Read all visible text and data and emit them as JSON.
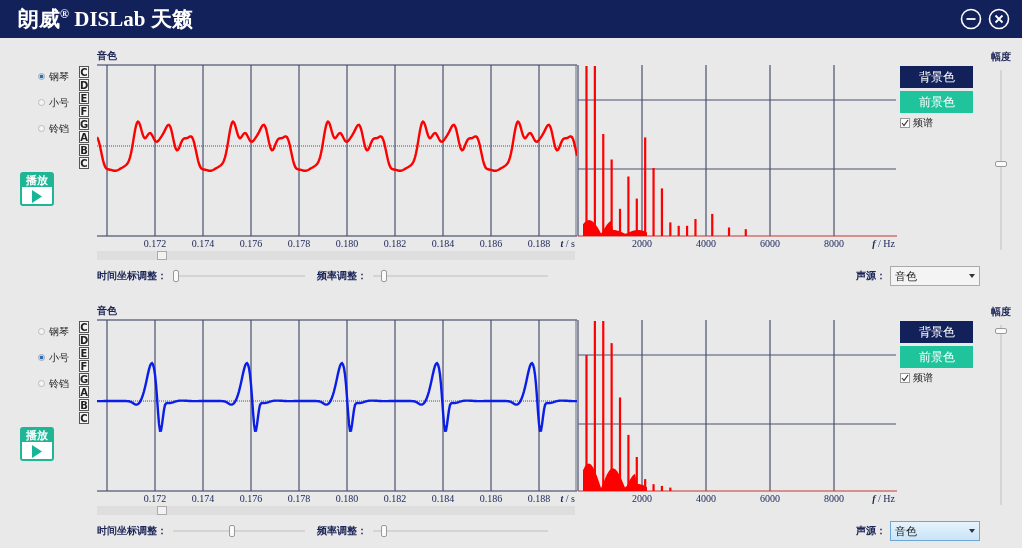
{
  "window": {
    "title": "朗威$^{®}$ DISLab 天籁"
  },
  "panels": [
    {
      "title": "音色",
      "color": "#ff0000",
      "instruments": [
        {
          "label": "钢琴",
          "selected": true
        },
        {
          "label": "小号",
          "selected": false
        },
        {
          "label": "铃铛",
          "selected": false
        }
      ],
      "notes": [
        "C",
        "D",
        "E",
        "F",
        "G",
        "A",
        "B",
        "C"
      ],
      "play_button": {
        "label": "播放"
      },
      "time_axis": {
        "ticks": [
          "0.172",
          "0.174",
          "0.176",
          "0.178",
          "0.180",
          "0.182",
          "0.184",
          "0.186",
          "0.188"
        ],
        "label": "*t* / s"
      },
      "frequency_axis": {
        "ticks": [
          "2000",
          "4000",
          "6000",
          "8000"
        ],
        "label": "*f* / Hz"
      },
      "background_button": "背景色",
      "foreground_button": "前景色",
      "spectrum_checkbox": {
        "label": "频谱",
        "checked": true
      },
      "time_scale_slider": {
        "label": "时间坐标调整：",
        "level": 0.0
      },
      "frequency_slider": {
        "label": "频率调整：",
        "level": 0.05
      },
      "source": {
        "label": "声源：",
        "value": "音色",
        "focused": false
      },
      "amplitude": {
        "label": "幅度",
        "level": 0.47
      }
    },
    {
      "title": "音色",
      "color": "#0a1ee6",
      "instruments": [
        {
          "label": "钢琴",
          "selected": false
        },
        {
          "label": "小号",
          "selected": true
        },
        {
          "label": "铃铛",
          "selected": false
        }
      ],
      "notes": [
        "C",
        "D",
        "E",
        "F",
        "G",
        "A",
        "B",
        "C"
      ],
      "play_button": {
        "label": "播放"
      },
      "time_axis": {
        "ticks": [
          "0.172",
          "0.174",
          "0.176",
          "0.178",
          "0.180",
          "0.182",
          "0.184",
          "0.186",
          "0.188"
        ],
        "label": "*t* / s"
      },
      "frequency_axis": {
        "ticks": [
          "2000",
          "4000",
          "6000",
          "8000"
        ],
        "label": "*f* / Hz"
      },
      "background_button": "背景色",
      "foreground_button": "前景色",
      "spectrum_checkbox": {
        "label": "频谱",
        "checked": true
      },
      "time_scale_slider": {
        "label": "时间坐标调整：",
        "level": 0.45
      },
      "frequency_slider": {
        "label": "频率调整：",
        "level": 0.05
      },
      "source": {
        "label": "声源：",
        "value": "音色",
        "focused": true
      },
      "amplitude": {
        "label": "幅度",
        "level": 0.98
      }
    }
  ]
}
